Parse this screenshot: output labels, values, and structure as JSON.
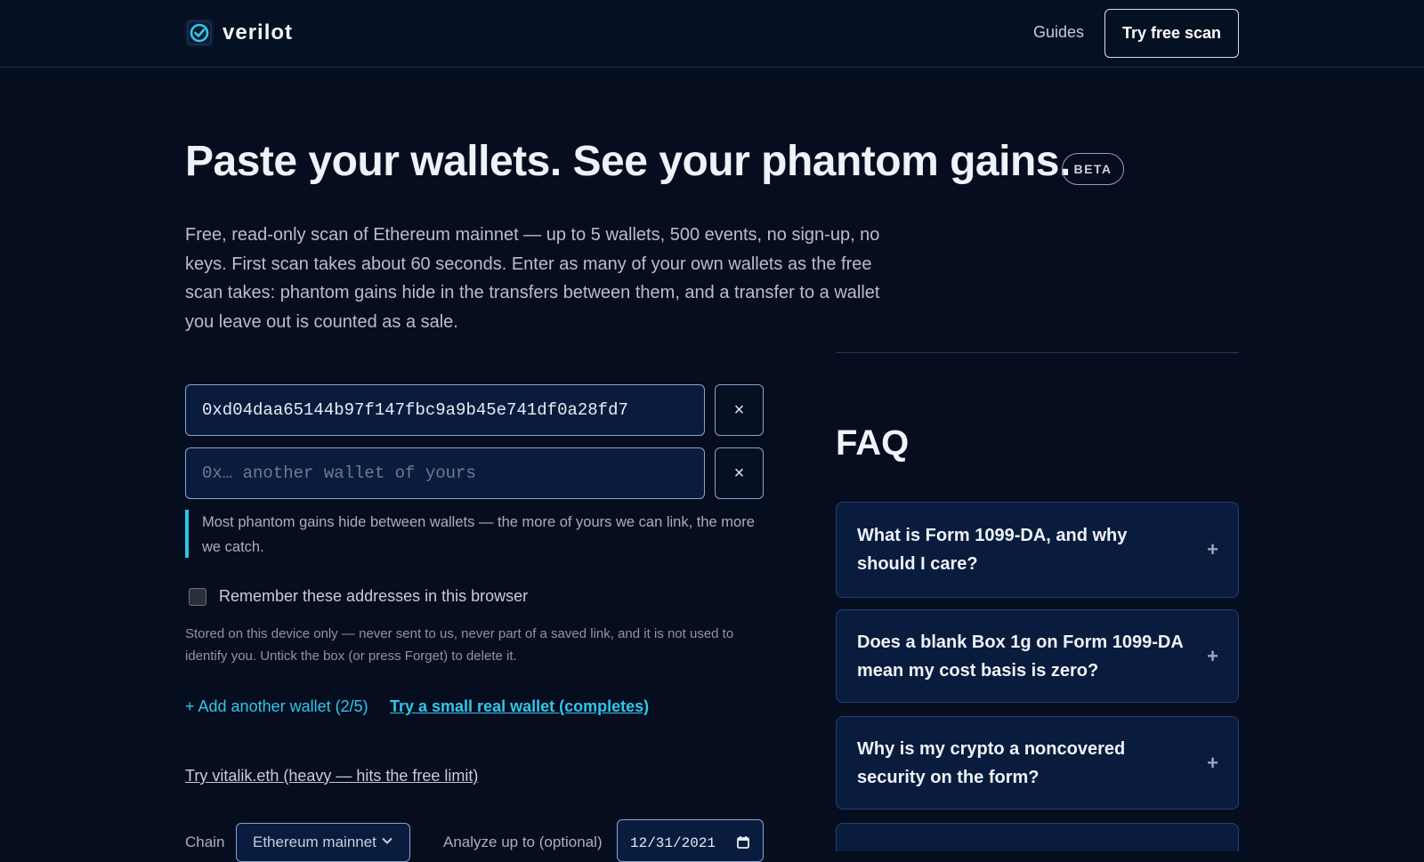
{
  "header": {
    "brand_name": "verilot",
    "nav_guides": "Guides",
    "cta_label": "Try free scan"
  },
  "hero": {
    "title": "Paste your wallets. See your phantom gains.",
    "badge": "BETA",
    "subtitle": "Free, read-only scan of Ethereum mainnet — up to 5 wallets, 500 events, no sign-up, no keys. First scan takes about 60 seconds. Enter as many of your own wallets as the free scan takes: phantom gains hide in the transfers between them, and a transfer to a wallet you leave out is counted as a sale."
  },
  "form": {
    "wallets": [
      {
        "value": "0xd04daa65144b97f147fbc9a9b45e741df0a28fd7",
        "placeholder": ""
      },
      {
        "value": "",
        "placeholder": "0x… another wallet of yours"
      }
    ],
    "remove_label": "×",
    "hint": "Most phantom gains hide between wallets — the more of yours we can link, the more we catch.",
    "remember_label": "Remember these addresses in this browser",
    "remember_checked": false,
    "stored_note": "Stored on this device only — never sent to us, never part of a saved link, and it is not used to identify you. Untick the box (or press Forget) to delete it.",
    "add_wallet": "+ Add another wallet (2/5)",
    "try_small": "Try a small real wallet (completes)",
    "try_vitalik": "Try vitalik.eth (heavy — hits the free limit)",
    "chain_label": "Chain",
    "chain_value": "Ethereum mainnet",
    "analyze_label": "Analyze up to (optional)",
    "date_value": "12/31/2021"
  },
  "faq": {
    "title": "FAQ",
    "items": [
      {
        "question": "What is Form 1099-DA, and why should I care?"
      },
      {
        "question": "Does a blank Box 1g on Form 1099-DA mean my cost basis is zero?"
      },
      {
        "question": "Why is my crypto a noncovered security on the form?"
      }
    ],
    "expand_icon": "+"
  },
  "colors": {
    "background": "#050d1f",
    "accent": "#2fc8ea",
    "input_bg": "#0a1c3d"
  }
}
